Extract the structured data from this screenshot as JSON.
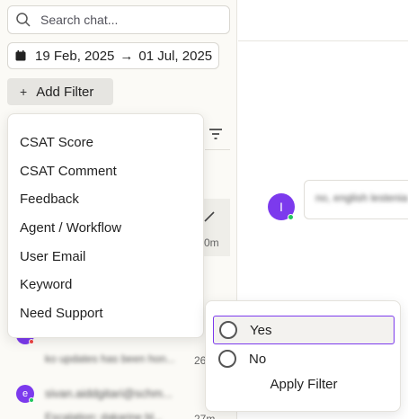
{
  "search": {
    "placeholder": "Search chat..."
  },
  "date_range": {
    "start": "19 Feb, 2025",
    "arrow": "→",
    "end": "01 Jul, 2025"
  },
  "add_filter": {
    "icon": "+",
    "label": "Add Filter"
  },
  "filter_menu": {
    "items": [
      {
        "label": "CSAT Score"
      },
      {
        "label": "CSAT Comment"
      },
      {
        "label": "Feedback"
      },
      {
        "label": "Agent / Workflow"
      },
      {
        "label": "User Email"
      },
      {
        "label": "Keyword"
      },
      {
        "label": "Need Support"
      }
    ]
  },
  "chat_list": {
    "time_fragments": [
      "0m",
      "26",
      "27m"
    ],
    "avatar_letters": [
      "e"
    ],
    "preview_lines": [
      "ko updates has been hon...",
      "sivan.aiddgitari@schm...",
      "Escalation: dakarine bl..."
    ]
  },
  "conversation": {
    "avatar_letter": "I",
    "message": "no, english lestenia"
  },
  "value_popover": {
    "options": [
      {
        "label": "Yes",
        "selected": true
      },
      {
        "label": "No",
        "selected": false
      }
    ],
    "apply_label": "Apply Filter"
  },
  "colors": {
    "accent": "#7c3aed",
    "online": "#22c55e",
    "offline": "#ef4444"
  }
}
